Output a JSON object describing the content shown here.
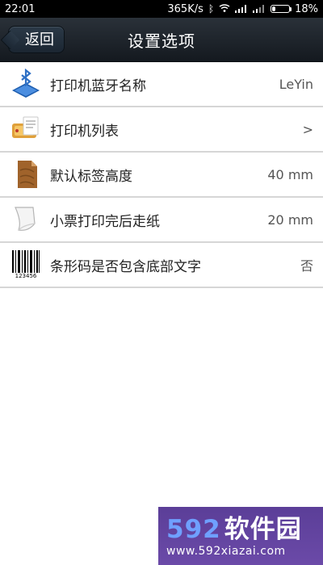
{
  "status_bar": {
    "time": "22:01",
    "speed": "365K/s",
    "battery": "18%",
    "battery_level": 0.18
  },
  "header": {
    "back_label": "返回",
    "title": "设置选项"
  },
  "settings": [
    {
      "label": "打印机蓝牙名称",
      "value": "LeYin"
    },
    {
      "label": "打印机列表",
      "value": ">"
    },
    {
      "label": "默认标签高度",
      "value": "40 mm"
    },
    {
      "label": "小票打印完后走纸",
      "value": "20 mm"
    },
    {
      "label": "条形码是否包含底部文字",
      "value": "否"
    }
  ],
  "barcode_icon_caption": "123456",
  "watermark": {
    "number": "592",
    "brand": "软件园",
    "url": "www.592xiazai.com"
  },
  "colors": {
    "header_bg": "#1c232b",
    "divider": "#d6d6d6",
    "text": "#222222",
    "value_text": "#555555",
    "watermark_bg": "#5f439e",
    "watermark_accent": "#6fa0ff"
  },
  "icons": {
    "row_0": "bluetooth-printer-icon",
    "row_1": "printer-list-icon",
    "row_2": "label-height-icon",
    "row_3": "paper-feed-icon",
    "row_4": "barcode-icon"
  }
}
